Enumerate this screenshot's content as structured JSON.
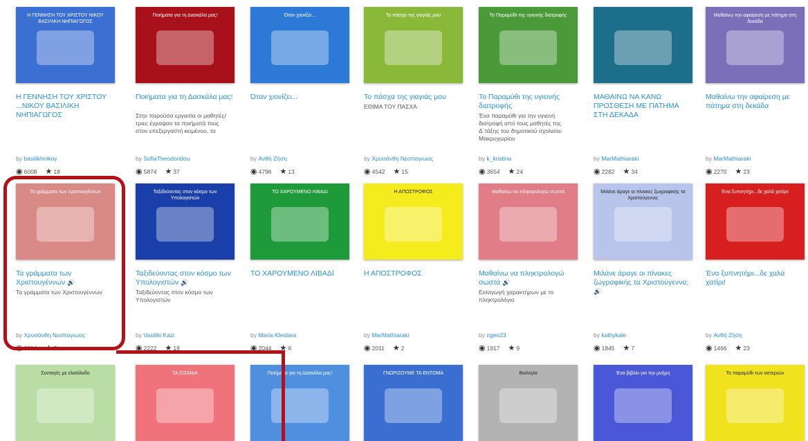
{
  "row1": [
    {
      "title": "Η ΓΕΝΝΗΣΗ ΤΟΥ ΧΡΙΣΤΟΥ ...ΝΙΚΟΥ ΒΑΣΙΛΙΚΗ ΝΗΠΙΑΓΩΓΟΣ",
      "desc": "",
      "author": "basilikhnikoy",
      "views": "6008",
      "stars": "18",
      "thumb_title": "Η ΓΕΝΝΗΣΗ ΤΟΥ ΧΡΙΣΤΟΥ ΝΙΚΟΥ ΒΑΣΙΛΙΚΗ ΝΗΠΙΑΓΩΓΟΣ",
      "thumb_color": "#3b6fd1"
    },
    {
      "title": "Ποιήματα για τη Δασκάλα μας!",
      "desc": "Στην παρούσα εργασία οι μαθητές/τριες έγραψαν τα ποιήματά τους στον επεξεργαστή κειμένου, τα",
      "author": "SofiaTheodoridou",
      "views": "5874",
      "stars": "37",
      "thumb_title": "Ποιήματα για τη Δασκάλα μας!",
      "thumb_color": "#a8101a"
    },
    {
      "title": "Όταν χιονίζει...",
      "desc": "",
      "author": "Ανθή Ζήση",
      "views": "4796",
      "stars": "13",
      "thumb_title": "Όταν χιονίζει...",
      "thumb_color": "#2d7ad6"
    },
    {
      "title": "Το πάσχα της γιαγιάς μου",
      "desc": "ΕΘΙΜΑ ΤΟΥ ΠΑΣΧΑ",
      "author": "Χρυσάνθη Νεσπαγιωος",
      "views": "4542",
      "stars": "15",
      "thumb_title": "Το πάσχα της γιαγιάς μου",
      "thumb_color": "#8ab93a"
    },
    {
      "title": "Το Παραμύθι της υγιεινής διατροφής",
      "desc": "Ένα παραμύθι για την υγιεινή διατροφή από τους μαθητές της Δ΄τάξης του δημοτικού σχολείου Μακρυχωρίου",
      "author": "k_kristina",
      "views": "3654",
      "stars": "24",
      "thumb_title": "Το Παραμύθι της υγιεινής διατροφής",
      "thumb_color": "#4a9a3a"
    },
    {
      "title": "ΜΑΘΑΙΝΩ ΝΑ ΚΑΝΩ ΠΡΟΣΘΕΣΗ ΜΕ ΠΑΤΗΜΑ ΣΤΗ ΔΕΚΑΔΑ",
      "desc": "",
      "author": "MarMathiaraki",
      "views": "2282",
      "stars": "34",
      "thumb_title": "",
      "thumb_color": "#1d6e8a"
    },
    {
      "title": "Μαθαίνω την αφαίρεση με πάτημα στη δεκάδα",
      "desc": "",
      "author": "MarMathiaraki",
      "views": "2270",
      "stars": "23",
      "thumb_title": "Μαθαίνω την αφαίρεση με πάτημα στη δεκάδα",
      "thumb_color": "#7a6fb8"
    }
  ],
  "row2": [
    {
      "title": "Τα γράμματα των Χριστουγέννων",
      "desc": "Τα γράμματα των Χριστουγέννων",
      "author": "Χρυσάνθη Νεσπαγιωος",
      "views": "2314",
      "stars": "7",
      "thumb_title": "Τα γράμματα των Χριστουγέννων",
      "thumb_color": "#d98a86",
      "audio": "🔊"
    },
    {
      "title": "Ταξιδεύοντας στον κόσμο των Υπολογιστών",
      "desc": "Ταξιδεύοντας στον κόσμο των Υπολογιστών",
      "author": "Vasiliki Kazi",
      "views": "2222",
      "stars": "19",
      "thumb_title": "Ταξιδεύοντας στον κόσμο των Υπολογιστών",
      "thumb_color": "#1a3fa8",
      "audio": "🔊"
    },
    {
      "title": "ΤΟ ΧΑΡΟΥΜΕΝΟ ΛΙΒΑΔΙ",
      "desc": "",
      "author": "Maria Kleidara",
      "views": "2044",
      "stars": "6",
      "thumb_title": "ΤΟ ΧΑΡΟΥΜΕΝΟ ΛΙΒΑΔΙ",
      "thumb_color": "#1e9a3a",
      "audio": ""
    },
    {
      "title": "Η ΑΠΟΣΤΡΟΦΟΣ",
      "desc": "",
      "author": "MarMathiaraki",
      "views": "2011",
      "stars": "2",
      "thumb_title": "Η ΑΠΟΣΤΡΟΦΟΣ",
      "thumb_color": "#f4ec1c",
      "audio": ""
    },
    {
      "title": "Μαθαίνω να πληκτρολογώ σωστά",
      "desc": "Εισαγωγή χαρακτήρων με το πληκτρολόγιο",
      "author": "ngeo23",
      "views": "1917",
      "stars": "9",
      "thumb_title": "Μαθαίνω να πληκτρολογώ σωστά",
      "thumb_color": "#e07d86",
      "audio": "🔊"
    },
    {
      "title": "Μιλάνε άραγε οι πίνακες ζωγραφικής τα Χριστούγεννα;",
      "desc": "",
      "author": "kathykale",
      "views": "1845",
      "stars": "7",
      "thumb_title": "Μιλάνε άραγε οι πίνακες ζωγραφικής τα Χριστούγεννα;",
      "thumb_color": "#b8c4ea",
      "audio": "🔊"
    },
    {
      "title": "Ένα ξυπνητήρι...δε χαλά χατίρι!",
      "desc": "",
      "author": "Ανθή Ζήση",
      "views": "1466",
      "stars": "23",
      "thumb_title": "Ένα ξυπνητήρι...δε χαλά χατίρι!",
      "thumb_color": "#d81f1f",
      "audio": ""
    }
  ],
  "row3": [
    {
      "thumb_title": "Συνταγές με ελαιόλαδο",
      "thumb_color": "#b9dda4"
    },
    {
      "thumb_title": "ΤΑ ΖΙΖΑΝΙΑ",
      "thumb_color": "#f0737c"
    },
    {
      "thumb_title": "Ποιήματα για τη Δασκάλα μας!",
      "thumb_color": "#4f8fe0"
    },
    {
      "thumb_title": "ΓΝΩΡΙΖΟΥΜΕ ΤΑ ΕΝΤΟΜΑ",
      "thumb_color": "#3a6fd1"
    },
    {
      "thumb_title": "Βιολογία",
      "thumb_color": "#b3b3b3"
    },
    {
      "thumb_title": "Ένα βιβλίο για την μνήμη",
      "thumb_color": "#4a58d8"
    },
    {
      "thumb_title": "Το παραμύθι των αστεριών",
      "thumb_color": "#f0e21c"
    }
  ],
  "labels": {
    "by": "by"
  }
}
